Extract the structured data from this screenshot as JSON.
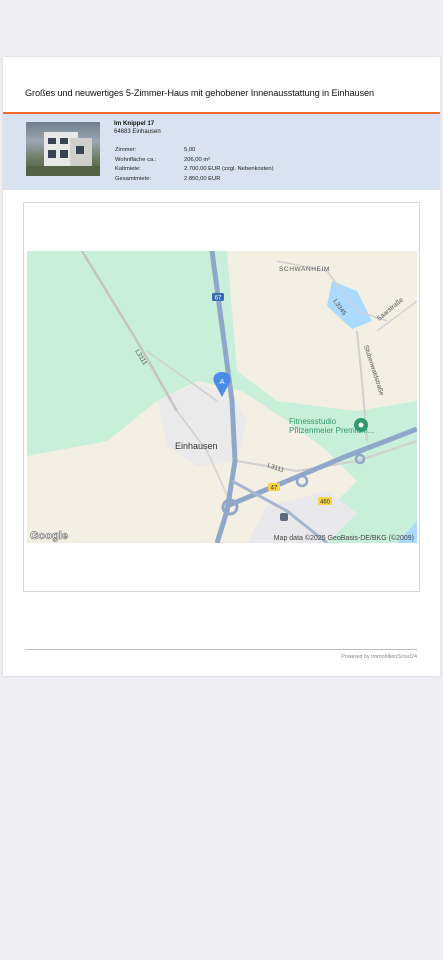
{
  "title": "Großes und neuwertiges 5-Zimmer-Haus mit gehobener Innenausstattung in Einhausen",
  "address": {
    "street": "Im Knippel 17",
    "city": "64683 Einhausen"
  },
  "facts": [
    {
      "label": "Zimmer:",
      "value": "5,00"
    },
    {
      "label": "Wohnfläche ca.:",
      "value": "206,00 m²"
    },
    {
      "label": "Kaltmiete:",
      "value": "2.700,00 EUR (zzgl. Nebenkosten)"
    },
    {
      "label": "Gesamtmiete:",
      "value": "2.850,00 EUR"
    }
  ],
  "map": {
    "labels": {
      "schwanheim": "SCHWANHEIM",
      "l3345": "L3345",
      "saarstrasse": "Saarstraße",
      "stubenwald": "Stubenwaldstraße",
      "l3111_a": "L3111",
      "l3111_b": "L3111",
      "einhausen": "Einhausen",
      "poi_line1": "Fitnessstudio",
      "poi_line2": "Pfitzenmeier Premium...",
      "a67_top": "67",
      "a67_bottom": "47",
      "b460": "460",
      "marker": "A",
      "attribution": "Map data ©2025 GeoBasis-DE/BKG (©2009)",
      "google": "Google"
    },
    "colors": {
      "green": "#c8efd9",
      "land": "#f3efe3",
      "motorway": "#8fa7c9",
      "water": "#aadaff",
      "marker": "#4a8de8",
      "poi": "#2f9a6e"
    }
  },
  "footer": {
    "powered": "Powered by ImmobilienScout24"
  },
  "colors": {
    "accent": "#f06a2b",
    "band": "#d8e2f0"
  }
}
